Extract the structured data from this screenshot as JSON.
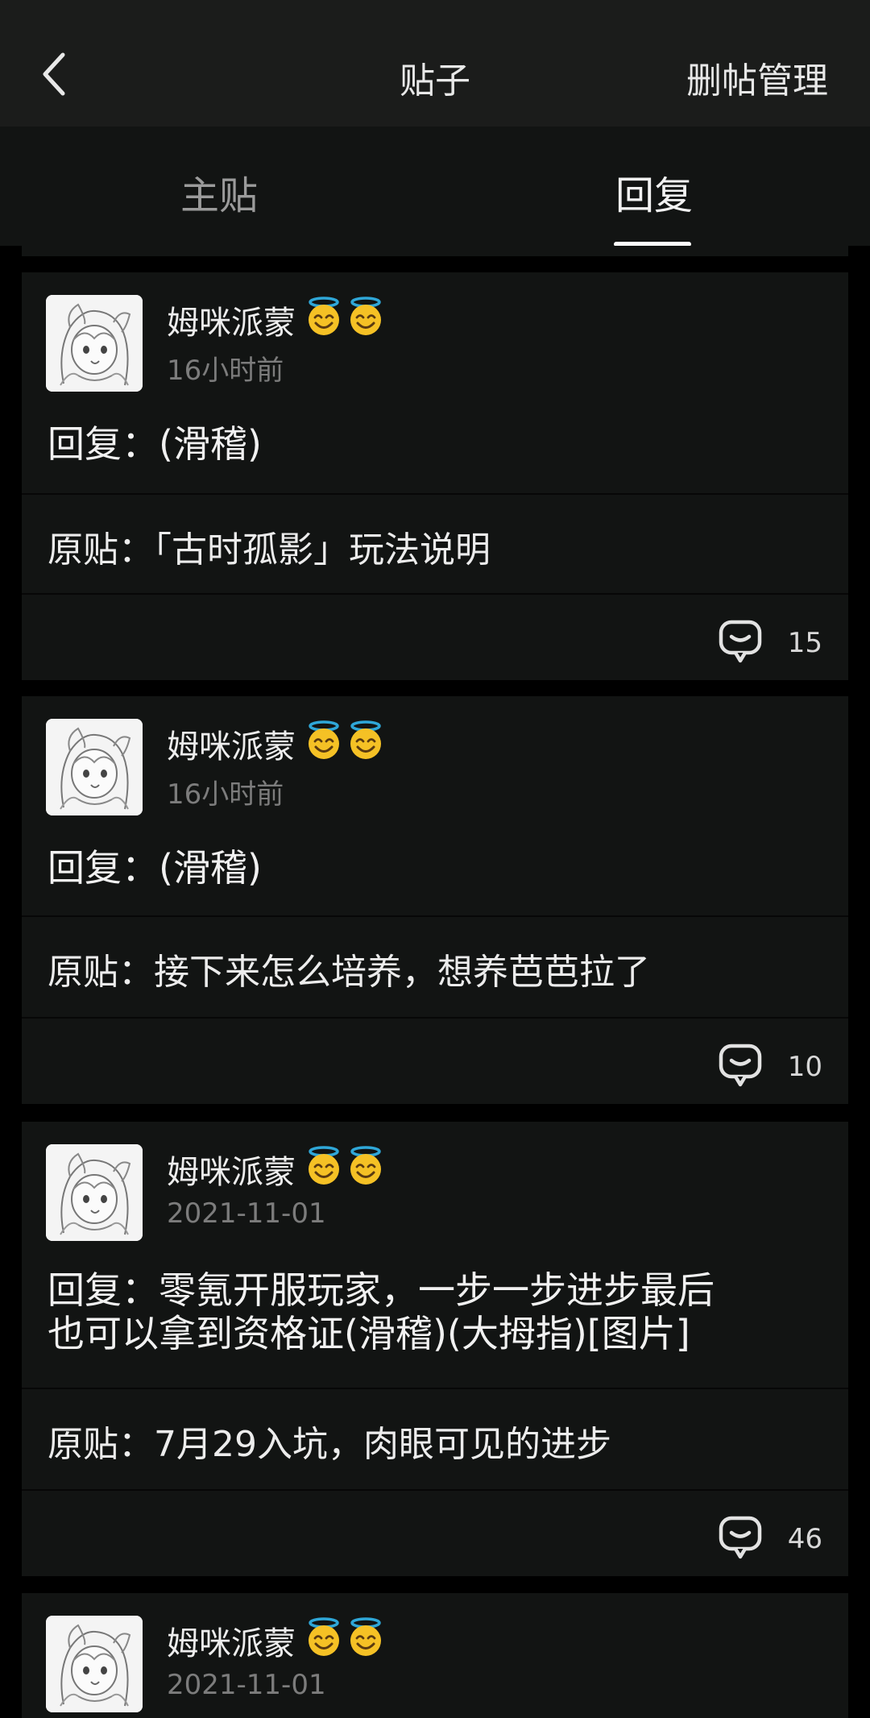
{
  "header": {
    "title": "贴子",
    "manage_label": "删帖管理"
  },
  "tabs": [
    {
      "label": "主贴",
      "active": false
    },
    {
      "label": "回复",
      "active": true
    }
  ],
  "posts": [
    {
      "username": "姆咪派蒙",
      "time": "16小时前",
      "reply": "回复：(滑稽)",
      "original": "原贴：「古时孤影」玩法说明",
      "comments": "15"
    },
    {
      "username": "姆咪派蒙",
      "time": "16小时前",
      "reply": "回复：(滑稽)",
      "original": "原贴：接下来怎么培养，想养芭芭拉了",
      "comments": "10"
    },
    {
      "username": "姆咪派蒙",
      "time": "2021-11-01",
      "reply_line1": "回复：零氪开服玩家，一步一步进步最后",
      "reply_line2": "也可以拿到资格证(滑稽)(大拇指)[图片]",
      "original": "原贴：7月29入坑，肉眼可见的进步",
      "comments": "46"
    },
    {
      "username": "姆咪派蒙",
      "time": "2021-11-01"
    }
  ],
  "colors": {
    "header_bg": "#1b1c1b",
    "card_bg": "#121413",
    "page_bg": "#000000",
    "badge": "#f5c125",
    "halo": "#2fa7d8"
  },
  "icons": {
    "back": "chevron-left-icon",
    "comment": "comment-bubble-icon",
    "badge": "smiling-face-with-halo-icon"
  }
}
